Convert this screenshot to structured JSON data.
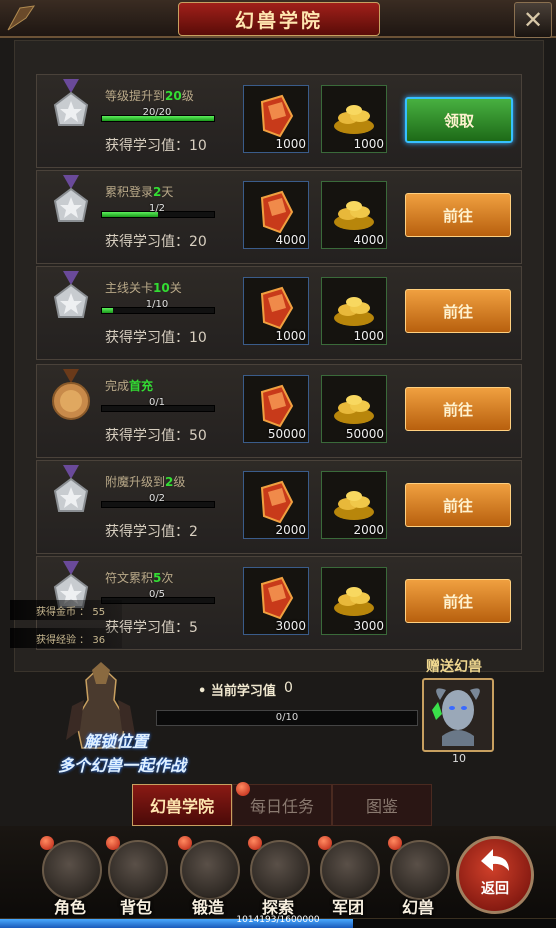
{
  "header": {
    "title": "幻兽学院",
    "close_icon": "close-x-icon"
  },
  "quests": [
    {
      "title_pre": "等级提升到",
      "title_hl": "20",
      "title_post": "级",
      "progress_text": "20/20",
      "progress": 1.0,
      "points_label": "获得学习值：10",
      "reward1": "1000",
      "reward2": "1000",
      "button": "领取",
      "button_style": "claim",
      "medal": "silver"
    },
    {
      "title_pre": "累积登录",
      "title_hl": "2",
      "title_post": "天",
      "progress_text": "1/2",
      "progress": 0.5,
      "points_label": "获得学习值：20",
      "reward1": "4000",
      "reward2": "4000",
      "button": "前往",
      "button_style": "go",
      "medal": "silver"
    },
    {
      "title_pre": "主线关卡",
      "title_hl": "10",
      "title_post": "关",
      "progress_text": "1/10",
      "progress": 0.1,
      "points_label": "获得学习值：10",
      "reward1": "1000",
      "reward2": "1000",
      "button": "前往",
      "button_style": "go",
      "medal": "silver"
    },
    {
      "title_pre": "完成",
      "title_hl": "首充",
      "title_post": "",
      "progress_text": "0/1",
      "progress": 0,
      "points_label": "获得学习值：50",
      "reward1": "50000",
      "reward2": "50000",
      "button": "前往",
      "button_style": "go",
      "medal": "bronze"
    },
    {
      "title_pre": "附魔升级到",
      "title_hl": "2",
      "title_post": "级",
      "progress_text": "0/2",
      "progress": 0,
      "points_label": "获得学习值：2",
      "reward1": "2000",
      "reward2": "2000",
      "button": "前往",
      "button_style": "go",
      "medal": "silver"
    },
    {
      "title_pre": "符文累积",
      "title_hl": "5",
      "title_post": "次",
      "progress_text": "0/5",
      "progress": 0,
      "points_label": "获得学习值：5",
      "reward1": "3000",
      "reward2": "3000",
      "button": "前往",
      "button_style": "go",
      "medal": "silver"
    }
  ],
  "gains": {
    "gold": "获得金币 ： 55",
    "exp": "获得经验 ： 36"
  },
  "progress_panel": {
    "current_label": "• 当前学习值",
    "current_value": "0",
    "bar_text": "0/10",
    "bar_progress": 0,
    "unlock_line1": "解锁位置",
    "unlock_line2": "多个幻兽一起作战",
    "gift_label": "赠送幻兽",
    "gift_count": "10"
  },
  "tabs": [
    {
      "label": "幻兽学院",
      "active": true
    },
    {
      "label": "每日任务",
      "active": false
    },
    {
      "label": "图鉴",
      "active": false
    }
  ],
  "nav": [
    {
      "label": "角色",
      "icon": "helmet-icon"
    },
    {
      "label": "背包",
      "icon": "bag-icon"
    },
    {
      "label": "锻造",
      "icon": "hammer-icon"
    },
    {
      "label": "探索",
      "icon": "magnifier-icon"
    },
    {
      "label": "军团",
      "icon": "gauntlet-icon"
    },
    {
      "label": "幻兽",
      "icon": "beast-icon"
    }
  ],
  "back_label": "返回",
  "exp_text": "1014193/1600000",
  "exp_progress": 0.634,
  "colors": {
    "highlight_green": "#33dd33",
    "go_button": "#e08a2a",
    "claim_button": "#3aa03a",
    "title_red": "#8a1a14"
  }
}
